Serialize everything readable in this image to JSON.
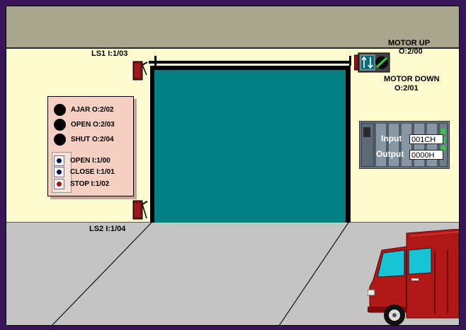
{
  "labels": {
    "ls1": "LS1  I:1/03",
    "ls2": "LS2  I:1/04",
    "motor_up_title": "MOTOR UP",
    "motor_up_addr": "O:2/00",
    "motor_down_title": "MOTOR DOWN",
    "motor_down_addr": "O:2/01"
  },
  "panel": {
    "lamps": [
      {
        "label": "AJAR O:2/02"
      },
      {
        "label": "OPEN  O:2/03"
      },
      {
        "label": "SHUT  O:2/04"
      }
    ],
    "buttons": [
      {
        "label": "OPEN   I:1/00"
      },
      {
        "label": "CLOSE I:1/01"
      },
      {
        "label": "STOP   I:1/02"
      }
    ]
  },
  "plc": {
    "input_label": "Input",
    "input_value": "001CH",
    "output_label": "Output",
    "output_value": "0000H"
  },
  "colors": {
    "door": "#008080",
    "wall": "#fffbd0",
    "ceiling": "#aaa68e",
    "floor": "#c4c4c4",
    "border": "#3a1458",
    "panel": "#f4cfc2",
    "truck": "#b01818"
  },
  "icons": {
    "motor": "up-down-arrows-icon",
    "limit_switch": "limit-switch-icon",
    "truck": "delivery-truck-icon"
  }
}
